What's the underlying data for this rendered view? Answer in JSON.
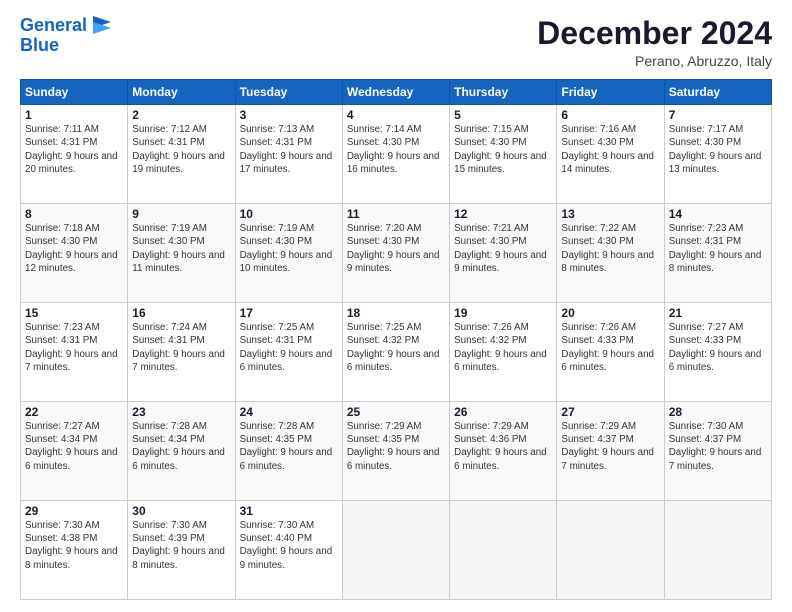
{
  "header": {
    "logo_line1": "General",
    "logo_line2": "Blue",
    "month": "December 2024",
    "location": "Perano, Abruzzo, Italy"
  },
  "weekdays": [
    "Sunday",
    "Monday",
    "Tuesday",
    "Wednesday",
    "Thursday",
    "Friday",
    "Saturday"
  ],
  "weeks": [
    [
      {
        "day": "1",
        "sunrise": "7:11 AM",
        "sunset": "4:31 PM",
        "daylight": "9 hours and 20 minutes."
      },
      {
        "day": "2",
        "sunrise": "7:12 AM",
        "sunset": "4:31 PM",
        "daylight": "9 hours and 19 minutes."
      },
      {
        "day": "3",
        "sunrise": "7:13 AM",
        "sunset": "4:31 PM",
        "daylight": "9 hours and 17 minutes."
      },
      {
        "day": "4",
        "sunrise": "7:14 AM",
        "sunset": "4:30 PM",
        "daylight": "9 hours and 16 minutes."
      },
      {
        "day": "5",
        "sunrise": "7:15 AM",
        "sunset": "4:30 PM",
        "daylight": "9 hours and 15 minutes."
      },
      {
        "day": "6",
        "sunrise": "7:16 AM",
        "sunset": "4:30 PM",
        "daylight": "9 hours and 14 minutes."
      },
      {
        "day": "7",
        "sunrise": "7:17 AM",
        "sunset": "4:30 PM",
        "daylight": "9 hours and 13 minutes."
      }
    ],
    [
      {
        "day": "8",
        "sunrise": "7:18 AM",
        "sunset": "4:30 PM",
        "daylight": "9 hours and 12 minutes."
      },
      {
        "day": "9",
        "sunrise": "7:19 AM",
        "sunset": "4:30 PM",
        "daylight": "9 hours and 11 minutes."
      },
      {
        "day": "10",
        "sunrise": "7:19 AM",
        "sunset": "4:30 PM",
        "daylight": "9 hours and 10 minutes."
      },
      {
        "day": "11",
        "sunrise": "7:20 AM",
        "sunset": "4:30 PM",
        "daylight": "9 hours and 9 minutes."
      },
      {
        "day": "12",
        "sunrise": "7:21 AM",
        "sunset": "4:30 PM",
        "daylight": "9 hours and 9 minutes."
      },
      {
        "day": "13",
        "sunrise": "7:22 AM",
        "sunset": "4:30 PM",
        "daylight": "9 hours and 8 minutes."
      },
      {
        "day": "14",
        "sunrise": "7:23 AM",
        "sunset": "4:31 PM",
        "daylight": "9 hours and 8 minutes."
      }
    ],
    [
      {
        "day": "15",
        "sunrise": "7:23 AM",
        "sunset": "4:31 PM",
        "daylight": "9 hours and 7 minutes."
      },
      {
        "day": "16",
        "sunrise": "7:24 AM",
        "sunset": "4:31 PM",
        "daylight": "9 hours and 7 minutes."
      },
      {
        "day": "17",
        "sunrise": "7:25 AM",
        "sunset": "4:31 PM",
        "daylight": "9 hours and 6 minutes."
      },
      {
        "day": "18",
        "sunrise": "7:25 AM",
        "sunset": "4:32 PM",
        "daylight": "9 hours and 6 minutes."
      },
      {
        "day": "19",
        "sunrise": "7:26 AM",
        "sunset": "4:32 PM",
        "daylight": "9 hours and 6 minutes."
      },
      {
        "day": "20",
        "sunrise": "7:26 AM",
        "sunset": "4:33 PM",
        "daylight": "9 hours and 6 minutes."
      },
      {
        "day": "21",
        "sunrise": "7:27 AM",
        "sunset": "4:33 PM",
        "daylight": "9 hours and 6 minutes."
      }
    ],
    [
      {
        "day": "22",
        "sunrise": "7:27 AM",
        "sunset": "4:34 PM",
        "daylight": "9 hours and 6 minutes."
      },
      {
        "day": "23",
        "sunrise": "7:28 AM",
        "sunset": "4:34 PM",
        "daylight": "9 hours and 6 minutes."
      },
      {
        "day": "24",
        "sunrise": "7:28 AM",
        "sunset": "4:35 PM",
        "daylight": "9 hours and 6 minutes."
      },
      {
        "day": "25",
        "sunrise": "7:29 AM",
        "sunset": "4:35 PM",
        "daylight": "9 hours and 6 minutes."
      },
      {
        "day": "26",
        "sunrise": "7:29 AM",
        "sunset": "4:36 PM",
        "daylight": "9 hours and 6 minutes."
      },
      {
        "day": "27",
        "sunrise": "7:29 AM",
        "sunset": "4:37 PM",
        "daylight": "9 hours and 7 minutes."
      },
      {
        "day": "28",
        "sunrise": "7:30 AM",
        "sunset": "4:37 PM",
        "daylight": "9 hours and 7 minutes."
      }
    ],
    [
      {
        "day": "29",
        "sunrise": "7:30 AM",
        "sunset": "4:38 PM",
        "daylight": "9 hours and 8 minutes."
      },
      {
        "day": "30",
        "sunrise": "7:30 AM",
        "sunset": "4:39 PM",
        "daylight": "9 hours and 8 minutes."
      },
      {
        "day": "31",
        "sunrise": "7:30 AM",
        "sunset": "4:40 PM",
        "daylight": "9 hours and 9 minutes."
      },
      null,
      null,
      null,
      null
    ]
  ]
}
